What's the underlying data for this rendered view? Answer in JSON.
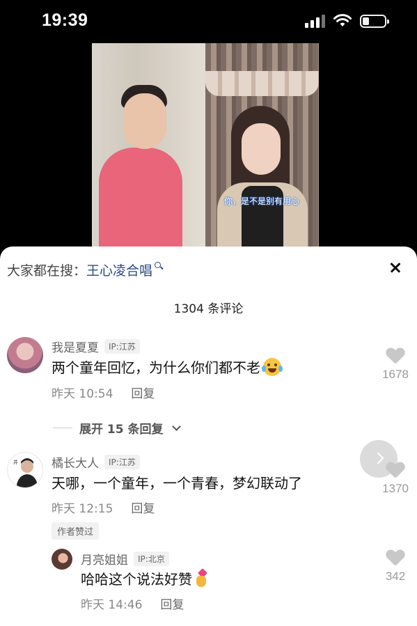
{
  "status_bar": {
    "time": "19:39"
  },
  "video": {
    "subtitle": "你，是不是别有用心"
  },
  "search_bar": {
    "prefix": "大家都在搜：",
    "term": "王心凌合唱"
  },
  "comments_header": {
    "count": "1304 条评论"
  },
  "comments": [
    {
      "user": "我是夏夏",
      "ip": "IP:江苏",
      "text": "两个童年回忆，为什么你们都不老",
      "emoji": "crying-laughing-emoji",
      "time": "昨天 10:54",
      "reply_label": "回复",
      "likes": "1678"
    },
    {
      "user": "橘长大人",
      "ip": "IP:江苏",
      "text": "天哪，一个童年，一个青春，梦幻联动了",
      "time": "昨天 12:15",
      "reply_label": "回复",
      "likes": "1370",
      "badge": "作者赞过"
    }
  ],
  "expand_replies": {
    "label": "展开 15 条回复"
  },
  "reply": {
    "user": "月亮姐姐",
    "ip": "IP:北京",
    "text": "哈哈这个说法好赞",
    "emoji": "heart-hand-emoji",
    "time": "昨天 14:46",
    "reply_label": "回复",
    "likes": "342"
  },
  "colors": {
    "search_term": "#2a4a86",
    "sheet_bg": "#ffffff",
    "meta_gray": "#888888"
  }
}
